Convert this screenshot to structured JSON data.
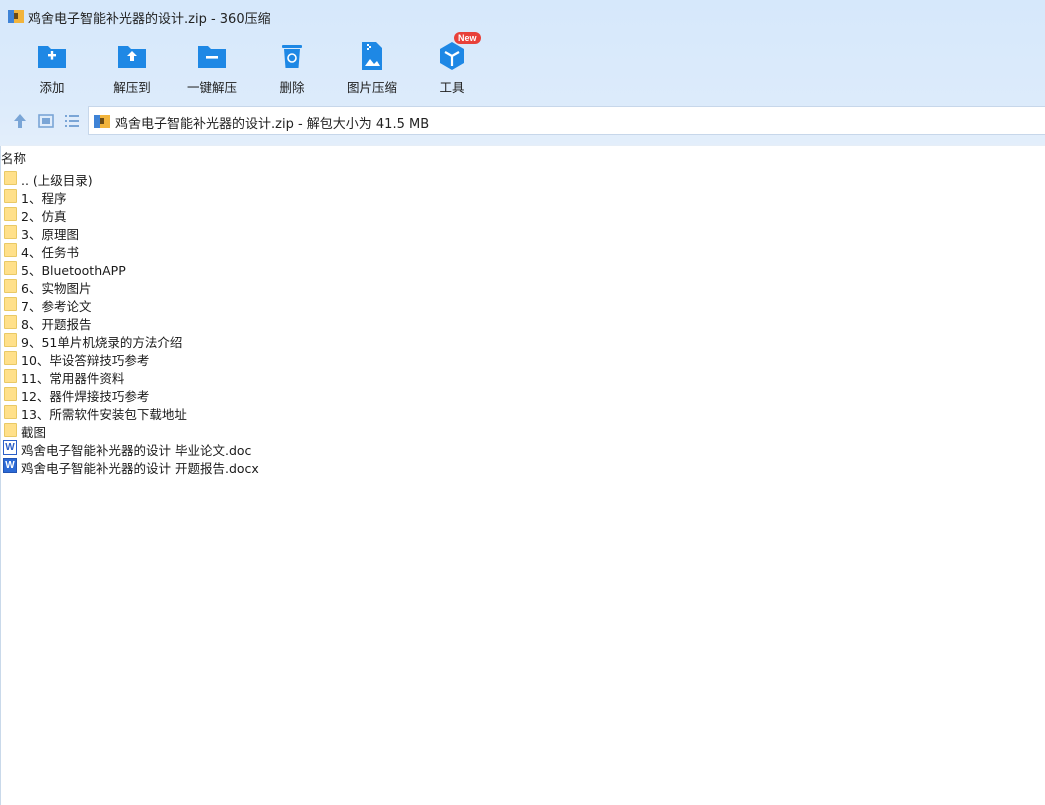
{
  "window": {
    "title": "鸡舍电子智能补光器的设计.zip - 360压缩"
  },
  "toolbar": {
    "items": [
      {
        "label": "添加",
        "icon": "add-folder-icon"
      },
      {
        "label": "解压到",
        "icon": "extract-to-icon"
      },
      {
        "label": "一键解压",
        "icon": "one-click-extract-icon"
      },
      {
        "label": "删除",
        "icon": "trash-icon"
      },
      {
        "label": "图片压缩",
        "icon": "image-compress-icon"
      },
      {
        "label": "工具",
        "icon": "tools-cube-icon",
        "badge": "New"
      }
    ]
  },
  "address": {
    "text": "鸡舍电子智能补光器的设计.zip - 解包大小为 41.5 MB"
  },
  "list": {
    "column_name": "名称",
    "items": [
      {
        "name": ".. (上级目录)",
        "type": "folder"
      },
      {
        "name": "1、程序",
        "type": "folder"
      },
      {
        "name": "2、仿真",
        "type": "folder"
      },
      {
        "name": "3、原理图",
        "type": "folder"
      },
      {
        "name": "4、任务书",
        "type": "folder"
      },
      {
        "name": "5、BluetoothAPP",
        "type": "folder"
      },
      {
        "name": "6、实物图片",
        "type": "folder"
      },
      {
        "name": "7、参考论文",
        "type": "folder"
      },
      {
        "name": "8、开题报告",
        "type": "folder"
      },
      {
        "name": "9、51单片机烧录的方法介绍",
        "type": "folder"
      },
      {
        "name": "10、毕设答辩技巧参考",
        "type": "folder"
      },
      {
        "name": "11、常用器件资料",
        "type": "folder"
      },
      {
        "name": "12、器件焊接技巧参考",
        "type": "folder"
      },
      {
        "name": "13、所需软件安装包下载地址",
        "type": "folder"
      },
      {
        "name": "截图",
        "type": "folder"
      },
      {
        "name": "鸡舍电子智能补光器的设计 毕业论文.doc",
        "type": "doc"
      },
      {
        "name": "鸡舍电子智能补光器的设计 开题报告.docx",
        "type": "docx"
      }
    ]
  },
  "colors": {
    "accent": "#1e88e5",
    "toolbar_bg": "#d9e9fb",
    "folder": "#ffe08a",
    "badge": "#e8413a"
  }
}
